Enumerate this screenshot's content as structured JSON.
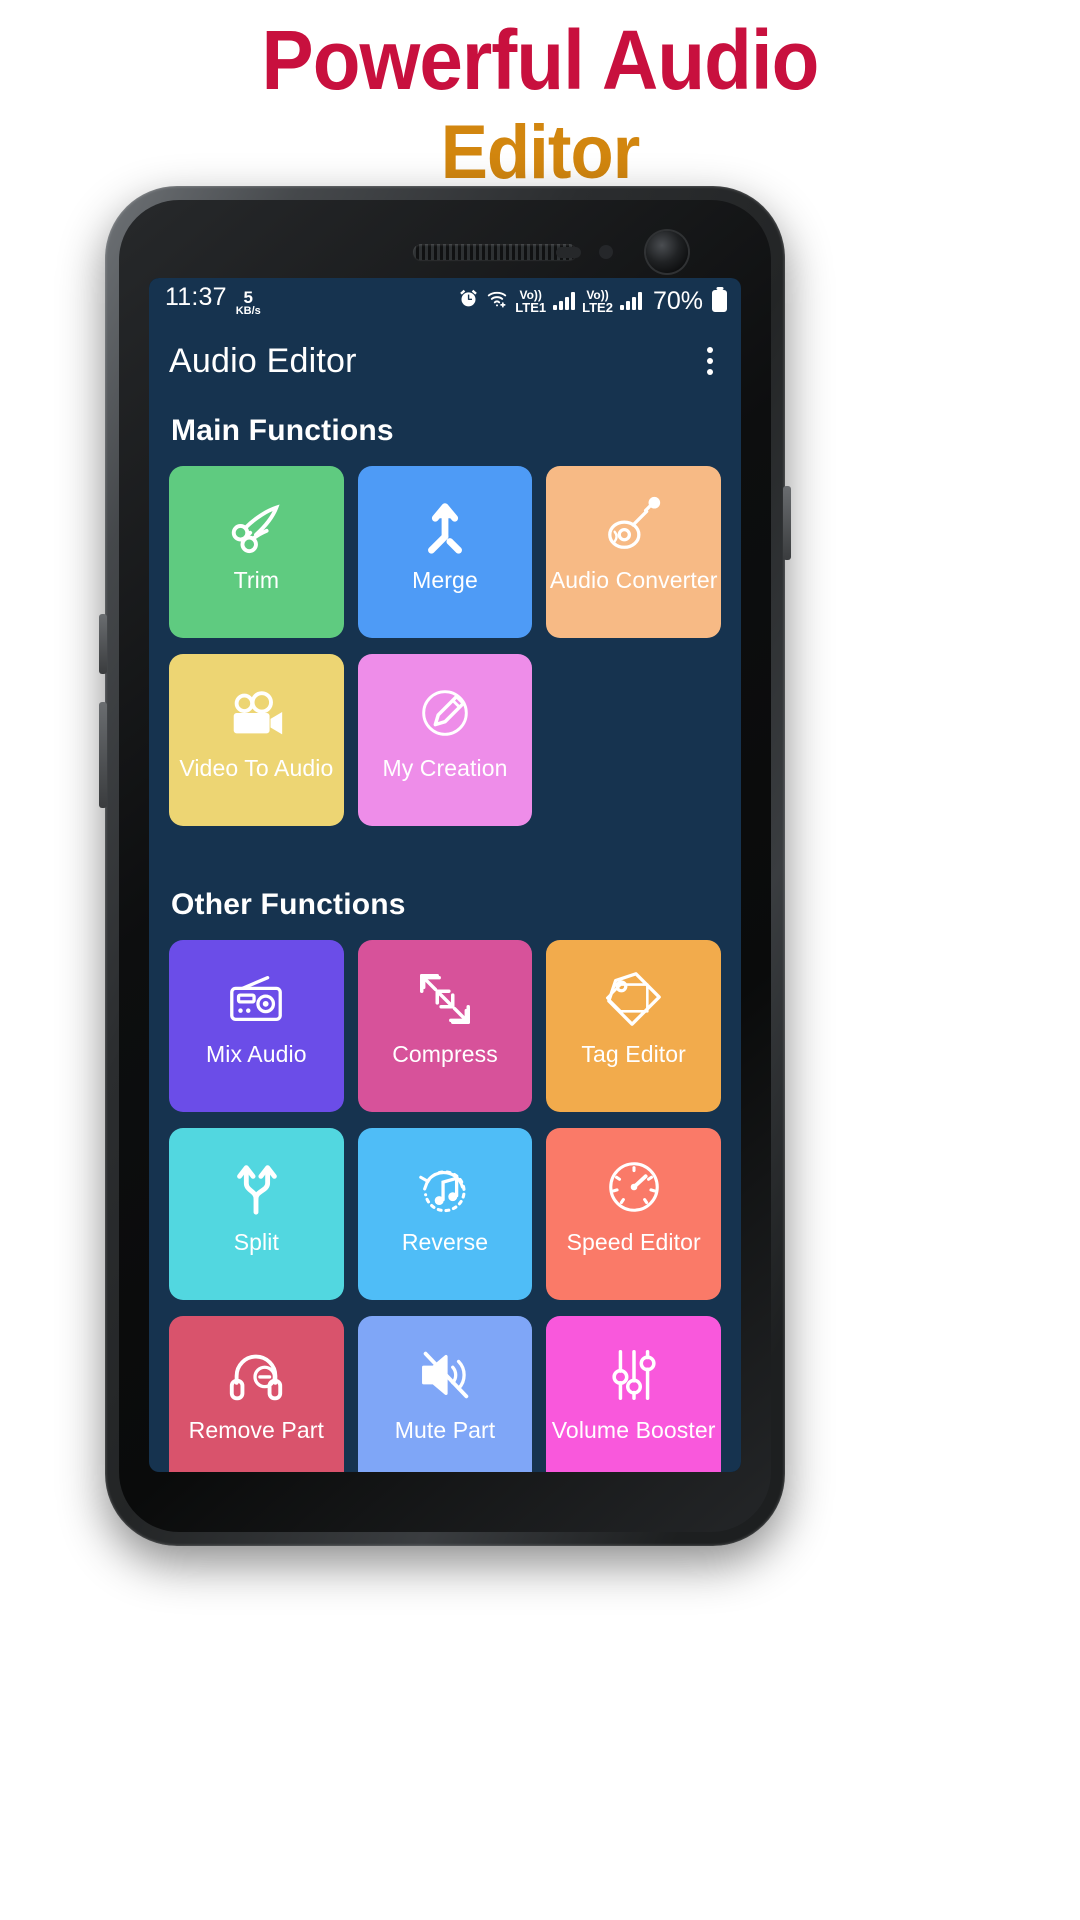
{
  "promo": {
    "line1": "Powerful Audio",
    "line2": "Editor",
    "line1_color": "#C8103E",
    "line2_color": "#D2860F"
  },
  "statusbar": {
    "time": "11:37",
    "net_speed_value": "5",
    "net_speed_unit": "KB/s",
    "alarm_icon": "alarm-icon",
    "wifi_icon": "wifi-icon",
    "volte1_line1": "Vo))",
    "volte1_line2": "LTE1",
    "volte2_line1": "Vo))",
    "volte2_line2": "LTE2",
    "battery_percent": "70%",
    "battery_icon": "battery-icon"
  },
  "appbar": {
    "title": "Audio Editor",
    "overflow_icon": "more-vertical-icon"
  },
  "theme": {
    "screen_background": "#16334f",
    "appbar_background": "#1a3a5a",
    "text": "#ffffff"
  },
  "sections": [
    {
      "title": "Main Functions",
      "tiles": [
        {
          "label": "Trim",
          "color": "#5FCB80",
          "icon": "scissors-icon"
        },
        {
          "label": "Merge",
          "color": "#4E9BF6",
          "icon": "merge-arrow-icon"
        },
        {
          "label": "Audio Converter",
          "color": "#F7BA85",
          "icon": "guitar-mic-icon"
        },
        {
          "label": "Video To Audio",
          "color": "#EDD573",
          "icon": "movie-camera-icon"
        },
        {
          "label": "My Creation",
          "color": "#EE8DE9",
          "icon": "pencil-circle-icon"
        }
      ]
    },
    {
      "title": "Other Functions",
      "tiles": [
        {
          "label": "Mix Audio",
          "color": "#6B4DE8",
          "icon": "radio-icon"
        },
        {
          "label": "Compress",
          "color": "#D7529A",
          "icon": "compress-arrows-icon"
        },
        {
          "label": "Tag Editor",
          "color": "#F2AB4C",
          "icon": "tag-icon"
        },
        {
          "label": "Split",
          "color": "#52D7E0",
          "icon": "split-arrows-icon"
        },
        {
          "label": "Reverse",
          "color": "#4FBDF7",
          "icon": "reverse-note-icon"
        },
        {
          "label": "Speed Editor",
          "color": "#FA7A68",
          "icon": "speedometer-icon"
        },
        {
          "label": "Remove Part",
          "color": "#D9536C",
          "icon": "headphone-minus-icon"
        },
        {
          "label": "Mute Part",
          "color": "#7FA6F7",
          "icon": "mute-speaker-icon"
        },
        {
          "label": "Volume Booster",
          "color": "#F958DC",
          "icon": "sliders-icon"
        }
      ]
    }
  ]
}
